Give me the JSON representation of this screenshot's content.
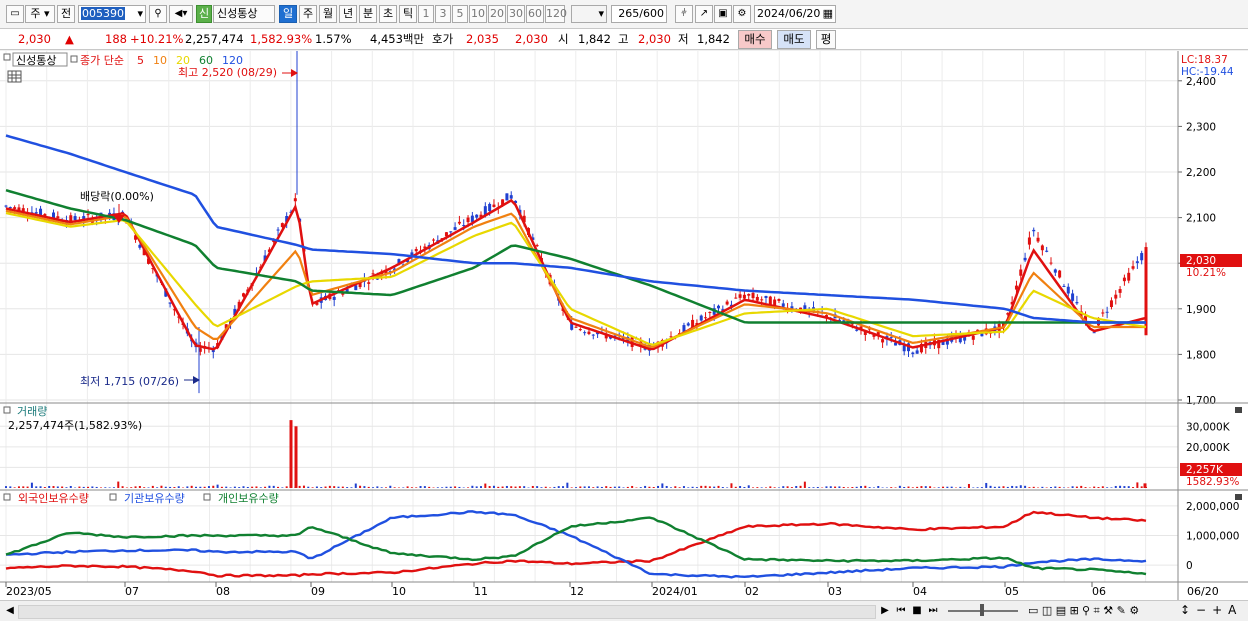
{
  "toolbar": {
    "market": "주",
    "prefix": "전",
    "code": "005390",
    "credit_badge": "신",
    "stock_name": "신성통상",
    "periods": [
      "일",
      "주",
      "월",
      "년",
      "분",
      "초",
      "틱"
    ],
    "active_period": "일",
    "intervals": [
      "1",
      "3",
      "5",
      "10",
      "20",
      "30",
      "60",
      "120"
    ],
    "count_value": "265",
    "count_max": "/600",
    "date": "2024/06/20"
  },
  "quote": {
    "price": "2,030",
    "change_arrow": "▲",
    "change": "188",
    "change_pct": "+10.21%",
    "volume": "2,257,474",
    "volume_ratio": "1,582.93%",
    "turnover": "1.57%",
    "trade_value": "4,453백만",
    "ask_label": "호가",
    "ask1": "2,035",
    "ask2": "2,030",
    "open_label": "시",
    "open": "1,842",
    "high_label": "고",
    "high": "2,030",
    "low_label": "저",
    "low": "1,842",
    "buy_button": "매수",
    "sell_button": "매도",
    "eval_button": "평"
  },
  "price_panel": {
    "name_tag": "신성통상",
    "ma_title": "종가 단순",
    "ma_periods": [
      {
        "label": "5",
        "color": "#e01010"
      },
      {
        "label": "10",
        "color": "#f08010"
      },
      {
        "label": "20",
        "color": "#e8d800"
      },
      {
        "label": "60",
        "color": "#108030"
      },
      {
        "label": "120",
        "color": "#2050e0"
      }
    ],
    "lc_label": "LC:18.37",
    "hc_label": "HC:-19.44",
    "high_annotation": "최고 2,520 (08/29)",
    "low_annotation": "최저 1,715 (07/26)",
    "dividend_annotation": "배당락(0.00%)",
    "price_tag": "2,030",
    "price_tag_pct": "10.21%",
    "y_ticks": [
      "2,400",
      "2,300",
      "2,200",
      "2,100",
      "2,000",
      "1,900",
      "1,800",
      "1,700"
    ]
  },
  "volume_panel": {
    "title": "거래량",
    "value": "2,257,474주(1,582.93%)",
    "y_ticks": [
      "30,000K",
      "20,000K",
      "10,000K"
    ],
    "tag": "2,257K",
    "tag_pct": "1582.93%"
  },
  "holdings_panel": {
    "legend": [
      {
        "label": "외국인보유수량",
        "color": "#e01010"
      },
      {
        "label": "기관보유수량",
        "color": "#2050e0"
      },
      {
        "label": "개인보유수량",
        "color": "#108030"
      }
    ],
    "y_ticks": [
      "2,000,000",
      "1,000,000",
      "0"
    ]
  },
  "x_axis": {
    "labels": [
      "2023/05",
      "07",
      "08",
      "09",
      "10",
      "11",
      "12",
      "2024/01",
      "02",
      "03",
      "04",
      "05",
      "06"
    ],
    "end_label": "06/20"
  },
  "chart_data": {
    "type": "line",
    "title": "신성통상",
    "x_range": [
      "2023/05",
      "2024/06/20"
    ],
    "price": {
      "ylim": [
        1700,
        2450
      ],
      "x": [
        "2023/05",
        "2023/06",
        "2023/07",
        "2023/07/26",
        "2023/08",
        "2023/08/29",
        "2023/09",
        "2023/10",
        "2023/11",
        "2023/11/15",
        "2023/12",
        "2024/01",
        "2024/02",
        "2024/03",
        "2024/04",
        "2024/05",
        "2024/05/08",
        "2024/06",
        "2024/06/20"
      ],
      "close": [
        2125,
        2095,
        2105,
        1815,
        1815,
        2140,
        1905,
        1990,
        2100,
        2150,
        1865,
        1815,
        1930,
        1885,
        1810,
        1860,
        2075,
        1850,
        2030
      ],
      "series": [
        {
          "name": "5",
          "values": [
            2120,
            2090,
            2110,
            1820,
            1810,
            2130,
            1910,
            1990,
            2090,
            2140,
            1870,
            1810,
            1920,
            1880,
            1815,
            1860,
            2030,
            1850,
            1880
          ]
        },
        {
          "name": "10",
          "values": [
            2115,
            2085,
            2105,
            1860,
            1830,
            2030,
            1930,
            1980,
            2080,
            2110,
            1880,
            1815,
            1910,
            1890,
            1825,
            1860,
            1980,
            1860,
            1860
          ]
        },
        {
          "name": "20",
          "values": [
            2110,
            2080,
            2095,
            1910,
            1860,
            1950,
            1960,
            1970,
            2060,
            2090,
            1900,
            1820,
            1890,
            1900,
            1840,
            1850,
            1940,
            1880,
            1860
          ]
        },
        {
          "name": "60",
          "values": [
            2160,
            2120,
            2095,
            2040,
            1990,
            1960,
            1940,
            1930,
            1990,
            2040,
            2010,
            1950,
            1870,
            1870,
            1870,
            1870,
            1870,
            1870,
            1870
          ]
        },
        {
          "name": "120",
          "values": [
            2280,
            2240,
            2200,
            2150,
            2080,
            2040,
            2030,
            2020,
            2000,
            2000,
            1990,
            1960,
            1940,
            1930,
            1920,
            1900,
            1880,
            1870,
            1870
          ]
        }
      ],
      "high": {
        "value": 2520,
        "date": "08/29"
      },
      "low": {
        "value": 1715,
        "date": "07/26"
      }
    },
    "volume": {
      "ylim": [
        0,
        35000000
      ],
      "peaks": [
        {
          "date": "2023/08/29",
          "value": 33000000
        },
        {
          "date": "2023/08/30",
          "value": 30000000
        },
        {
          "date": "2024/06/20",
          "value": 2257474
        }
      ]
    },
    "holdings": {
      "ylim": [
        -500000,
        2300000
      ],
      "series": [
        {
          "name": "외국인보유수량",
          "values": [
            -100000,
            -20000,
            -50000,
            -200000,
            -350000,
            -350000,
            -300000,
            -250000,
            50000,
            150000,
            50000,
            150000,
            1300000,
            1400000,
            1200000,
            1300000,
            1800000,
            1600000,
            1500000
          ]
        },
        {
          "name": "기관보유수량",
          "values": [
            350000,
            450000,
            500000,
            500000,
            450000,
            450000,
            200000,
            1600000,
            1800000,
            1700000,
            1000000,
            -300000,
            -400000,
            -250000,
            -100000,
            -50000,
            100000,
            200000,
            150000
          ]
        },
        {
          "name": "개인보유수량",
          "values": [
            350000,
            1100000,
            950000,
            1000000,
            1000000,
            1000000,
            1300000,
            400000,
            200000,
            300000,
            1300000,
            1600000,
            200000,
            150000,
            150000,
            250000,
            -100000,
            -150000,
            -300000
          ]
        }
      ]
    }
  }
}
